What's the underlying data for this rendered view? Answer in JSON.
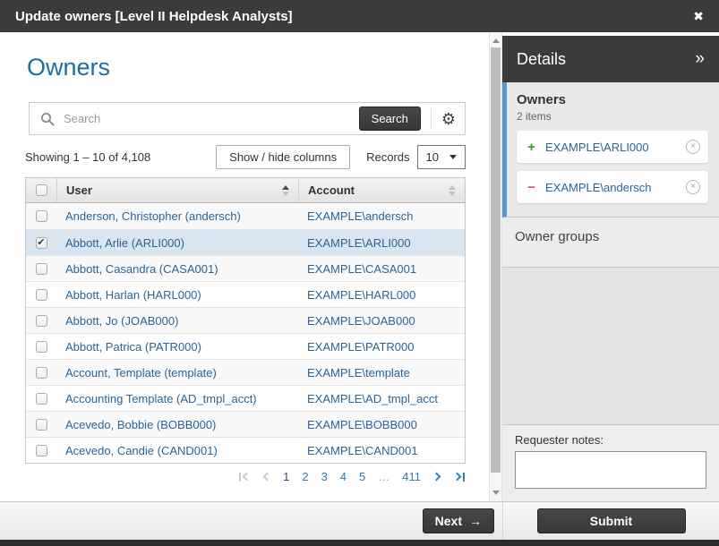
{
  "titlebar": {
    "title": "Update owners [Level II Helpdesk Analysts]"
  },
  "icons": {
    "close": "✖",
    "gear": "⚙",
    "collapse": "»",
    "check": "✔",
    "add": "+",
    "remove": "−",
    "dismiss": "×",
    "next_arrow": "→"
  },
  "main": {
    "heading": "Owners",
    "search": {
      "placeholder": "Search",
      "button_label": "Search"
    },
    "controls": {
      "showing_text": "Showing 1 – 10 of 4,108",
      "show_hide_label": "Show / hide columns",
      "records_label": "Records",
      "records_value": "10"
    },
    "table": {
      "columns": [
        "User",
        "Account"
      ],
      "sorted_column": "User",
      "sort_direction": "asc",
      "rows": [
        {
          "user": "Anderson, Christopher (andersch)",
          "account": "EXAMPLE\\andersch",
          "checked": false
        },
        {
          "user": "Abbott, Arlie (ARLI000)",
          "account": "EXAMPLE\\ARLI000",
          "checked": true
        },
        {
          "user": "Abbott, Casandra (CASA001)",
          "account": "EXAMPLE\\CASA001",
          "checked": false
        },
        {
          "user": "Abbott, Harlan (HARL000)",
          "account": "EXAMPLE\\HARL000",
          "checked": false
        },
        {
          "user": "Abbott, Jo (JOAB000)",
          "account": "EXAMPLE\\JOAB000",
          "checked": false
        },
        {
          "user": "Abbott, Patrica (PATR000)",
          "account": "EXAMPLE\\PATR000",
          "checked": false
        },
        {
          "user": "Account, Template (template)",
          "account": "EXAMPLE\\template",
          "checked": false
        },
        {
          "user": "Accounting Template (AD_tmpl_acct)",
          "account": "EXAMPLE\\AD_tmpl_acct",
          "checked": false
        },
        {
          "user": "Acevedo, Bobbie (BOBB000)",
          "account": "EXAMPLE\\BOBB000",
          "checked": false
        },
        {
          "user": "Acevedo, Candie (CAND001)",
          "account": "EXAMPLE\\CAND001",
          "checked": false
        }
      ]
    },
    "pagination": {
      "pages": [
        "1",
        "2",
        "3",
        "4",
        "5",
        "…",
        "411"
      ],
      "current_page": "1"
    },
    "next_label": "Next"
  },
  "sidebar": {
    "header_label": "Details",
    "owners": {
      "title": "Owners",
      "count": "2 items",
      "items": [
        {
          "operation": "add",
          "label": "EXAMPLE\\ARLI000"
        },
        {
          "operation": "remove",
          "label": "EXAMPLE\\andersch"
        }
      ]
    },
    "owner_groups_label": "Owner groups",
    "notes_label": "Requester notes:",
    "submit_label": "Submit"
  },
  "colors": {
    "titlebar_bg": "#3b3b3b",
    "heading_blue": "#1d6ea5",
    "link_blue": "#2a6496",
    "selected_row_bg": "#d9e5f0",
    "sidebar_accent_stripe": "#5e96c8",
    "add_green": "#2f9e2f",
    "remove_red": "#d9534f"
  }
}
